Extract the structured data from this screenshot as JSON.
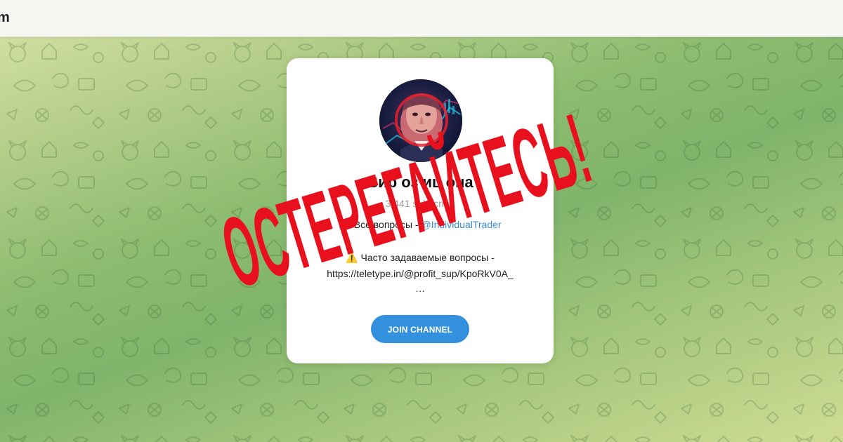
{
  "topbar": {
    "logo_fragment": "m"
  },
  "card": {
    "title": "Виртуоз Инвестиций",
    "title_visible": "Вир  оз  иц  она",
    "subscribers": "3  441 subscribe",
    "desc_prefix": "Все вопросы - ",
    "desc_link": "@IndividualTrader",
    "faq_line": "Часто задаваемые вопросы -",
    "faq_url": "https://teletype.in/@profit_sup/KpoRkV0A_",
    "ellipsis": "…",
    "join_label": "JOIN CHANNEL",
    "warning_icon": "warning-sign",
    "memo_icon": "memo"
  },
  "overlay": {
    "stamp_text": "ОСТЕРЕГАЙТЕСЬ!",
    "stamp_color": "#e8101c"
  },
  "colors": {
    "accent": "#3390dc",
    "link": "#3a8bd4"
  }
}
